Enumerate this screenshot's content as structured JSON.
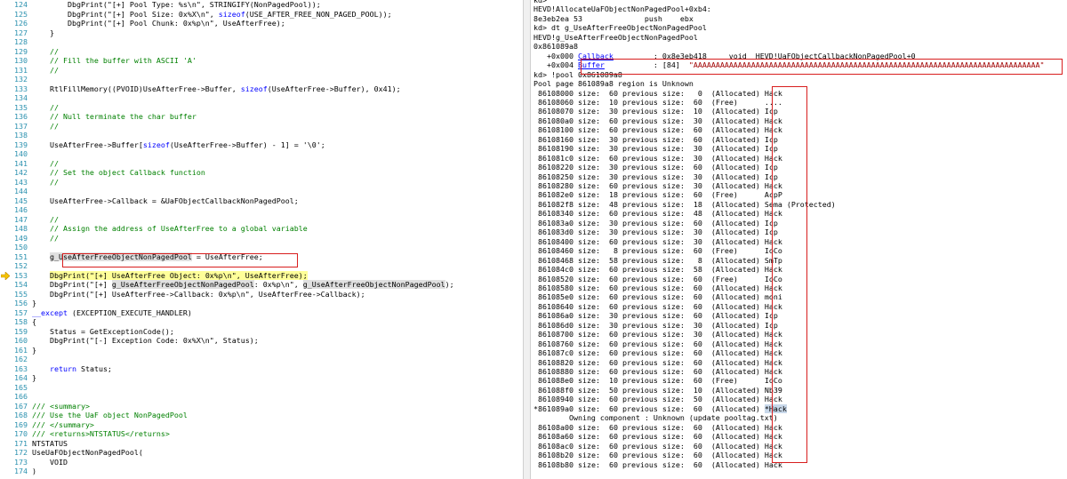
{
  "code": {
    "lines": [
      {
        "n": "124",
        "segs": [
          {
            "t": "        DbgPrint(\"[+] Pool Type: %s\\n\", STRINGIFY(NonPagedPool));"
          }
        ]
      },
      {
        "n": "125",
        "segs": [
          {
            "t": "        DbgPrint(\"[+] Pool Size: 0x%X\\n\", "
          },
          {
            "t": "sizeof",
            "c": "kw"
          },
          {
            "t": "(USE_AFTER_FREE_NON_PAGED_POOL));"
          }
        ]
      },
      {
        "n": "126",
        "segs": [
          {
            "t": "        DbgPrint(\"[+] Pool Chunk: 0x%p\\n\", UseAfterFree);"
          }
        ]
      },
      {
        "n": "127",
        "segs": [
          {
            "t": "    }"
          }
        ]
      },
      {
        "n": "128",
        "segs": [
          {
            "t": ""
          }
        ]
      },
      {
        "n": "129",
        "segs": [
          {
            "t": "    //",
            "c": "cm"
          }
        ]
      },
      {
        "n": "130",
        "segs": [
          {
            "t": "    // Fill the buffer with ASCII 'A'",
            "c": "cm"
          }
        ]
      },
      {
        "n": "131",
        "segs": [
          {
            "t": "    //",
            "c": "cm"
          }
        ]
      },
      {
        "n": "132",
        "segs": [
          {
            "t": ""
          }
        ]
      },
      {
        "n": "133",
        "segs": [
          {
            "t": "    RtlFillMemory((PVOID)UseAfterFree->Buffer, "
          },
          {
            "t": "sizeof",
            "c": "kw"
          },
          {
            "t": "(UseAfterFree->Buffer), 0x41);"
          }
        ]
      },
      {
        "n": "134",
        "segs": [
          {
            "t": ""
          }
        ]
      },
      {
        "n": "135",
        "segs": [
          {
            "t": "    //",
            "c": "cm"
          }
        ]
      },
      {
        "n": "136",
        "segs": [
          {
            "t": "    // Null terminate the char buffer",
            "c": "cm"
          }
        ]
      },
      {
        "n": "137",
        "segs": [
          {
            "t": "    //",
            "c": "cm"
          }
        ]
      },
      {
        "n": "138",
        "segs": [
          {
            "t": ""
          }
        ]
      },
      {
        "n": "139",
        "segs": [
          {
            "t": "    UseAfterFree->Buffer["
          },
          {
            "t": "sizeof",
            "c": "kw"
          },
          {
            "t": "(UseAfterFree->Buffer) - 1] = '\\0';"
          }
        ]
      },
      {
        "n": "140",
        "segs": [
          {
            "t": ""
          }
        ]
      },
      {
        "n": "141",
        "segs": [
          {
            "t": "    //",
            "c": "cm"
          }
        ]
      },
      {
        "n": "142",
        "segs": [
          {
            "t": "    // Set the object Callback function",
            "c": "cm"
          }
        ]
      },
      {
        "n": "143",
        "segs": [
          {
            "t": "    //",
            "c": "cm"
          }
        ]
      },
      {
        "n": "144",
        "segs": [
          {
            "t": ""
          }
        ]
      },
      {
        "n": "145",
        "segs": [
          {
            "t": "    UseAfterFree->Callback = &UaFObjectCallbackNonPagedPool;"
          }
        ]
      },
      {
        "n": "146",
        "segs": [
          {
            "t": ""
          }
        ]
      },
      {
        "n": "147",
        "segs": [
          {
            "t": "    //",
            "c": "cm"
          }
        ]
      },
      {
        "n": "148",
        "segs": [
          {
            "t": "    // Assign the address of UseAfterFree to a global variable",
            "c": "cm"
          }
        ]
      },
      {
        "n": "149",
        "segs": [
          {
            "t": "    //",
            "c": "cm"
          }
        ]
      },
      {
        "n": "150",
        "segs": [
          {
            "t": ""
          }
        ]
      },
      {
        "n": "151",
        "segs": [
          {
            "t": "    "
          },
          {
            "t": "g_UseAfterFreeObjectNonPagedPool",
            "c": "ref"
          },
          {
            "t": " = UseAfterFree;"
          }
        ]
      },
      {
        "n": "152",
        "segs": [
          {
            "t": ""
          }
        ]
      },
      {
        "n": "153",
        "segs": [
          {
            "t": "    "
          },
          {
            "t": "DbgPrint(\"[+] UseAfterFree Object: 0x%p\\n\", UseAfterFree);",
            "c": "hl"
          }
        ]
      },
      {
        "n": "154",
        "segs": [
          {
            "t": "    DbgPrint(\"[+] "
          },
          {
            "t": "g_UseAfterFreeObjectNonPagedPool",
            "c": "ref"
          },
          {
            "t": ": 0x%p\\n\", "
          },
          {
            "t": "g_UseAfterFreeObjectNonPagedPool",
            "c": "ref"
          },
          {
            "t": ");"
          }
        ]
      },
      {
        "n": "155",
        "segs": [
          {
            "t": "    DbgPrint(\"[+] UseAfterFree->Callback: 0x%p\\n\", UseAfterFree->Callback);"
          }
        ]
      },
      {
        "n": "156",
        "segs": [
          {
            "t": "}"
          }
        ]
      },
      {
        "n": "157",
        "segs": [
          {
            "t": "__except",
            "c": "kw"
          },
          {
            "t": " (EXCEPTION_EXECUTE_HANDLER)"
          }
        ]
      },
      {
        "n": "158",
        "segs": [
          {
            "t": "{"
          }
        ]
      },
      {
        "n": "159",
        "segs": [
          {
            "t": "    Status = GetExceptionCode();"
          }
        ]
      },
      {
        "n": "160",
        "segs": [
          {
            "t": "    DbgPrint(\"[-] Exception Code: 0x%X\\n\", Status);"
          }
        ]
      },
      {
        "n": "161",
        "segs": [
          {
            "t": "}"
          }
        ]
      },
      {
        "n": "162",
        "segs": [
          {
            "t": ""
          }
        ]
      },
      {
        "n": "163",
        "segs": [
          {
            "t": "    "
          },
          {
            "t": "return",
            "c": "kw"
          },
          {
            "t": " Status;"
          }
        ]
      },
      {
        "n": "164",
        "segs": [
          {
            "t": "}"
          }
        ]
      },
      {
        "n": "165",
        "segs": [
          {
            "t": ""
          }
        ]
      },
      {
        "n": "166",
        "segs": [
          {
            "t": ""
          }
        ]
      },
      {
        "n": "167",
        "segs": [
          {
            "t": "/// <summary>",
            "c": "cm"
          }
        ]
      },
      {
        "n": "168",
        "segs": [
          {
            "t": "/// Use the UaF object NonPagedPool",
            "c": "cm"
          }
        ]
      },
      {
        "n": "169",
        "segs": [
          {
            "t": "/// </summary>",
            "c": "cm"
          }
        ]
      },
      {
        "n": "170",
        "segs": [
          {
            "t": "/// <returns>NTSTATUS</returns>",
            "c": "cm"
          }
        ]
      },
      {
        "n": "171",
        "segs": [
          {
            "t": "NTSTATUS"
          }
        ]
      },
      {
        "n": "172",
        "segs": [
          {
            "t": "UseUaFObjectNonPagedPool("
          }
        ]
      },
      {
        "n": "173",
        "segs": [
          {
            "t": "    VOID"
          }
        ]
      },
      {
        "n": "174",
        "segs": [
          {
            "t": ")"
          }
        ]
      }
    ]
  },
  "debugger": {
    "header": [
      {
        "segs": [
          {
            "t": "kd>"
          }
        ]
      },
      {
        "segs": [
          {
            "t": "HEVD!AllocateUaFObjectNonPagedPool+0xb4:"
          }
        ]
      },
      {
        "segs": [
          {
            "t": "8e3eb2ea 53              push    ebx"
          }
        ]
      },
      {
        "segs": [
          {
            "t": "kd> dt g_UseAfterFreeObjectNonPagedPool"
          }
        ]
      },
      {
        "segs": [
          {
            "t": "HEVD!g_UseAfterFreeObjectNonPagedPool"
          }
        ]
      },
      {
        "segs": [
          {
            "t": "0x861089a8"
          }
        ]
      },
      {
        "segs": [
          {
            "t": "   +0x000 "
          },
          {
            "t": "Callback",
            "c": "lnk"
          },
          {
            "t": "         : 0x8e3eb418     void  HEVD!UaFObjectCallbackNonPagedPool+0"
          }
        ]
      },
      {
        "segs": [
          {
            "t": "   +0x004 "
          },
          {
            "t": "Buffer",
            "c": "lnk"
          },
          {
            "t": "           : [84]  "
          },
          {
            "t": "\"AAAAAAAAAAAAAAAAAAAAAAAAAAAAAAAAAAAAAAAAAAAAAAAAAAAAAAAAAAAAAAAAAAAAAAAAAAAAAA\"",
            "c": "strval"
          }
        ]
      },
      {
        "segs": [
          {
            "t": "kd> !pool 0x861089a8"
          }
        ]
      },
      {
        "segs": [
          {
            "t": "Pool page 861089a8 region is Unknown"
          }
        ]
      }
    ],
    "pool_rows": [
      [
        "86108000",
        "60",
        "0",
        "(Allocated)",
        "Hack"
      ],
      [
        "86108060",
        "10",
        "60",
        "(Free)",
        "...."
      ],
      [
        "86108070",
        "30",
        "10",
        "(Allocated)",
        "Icp"
      ],
      [
        "861080a0",
        "60",
        "30",
        "(Allocated)",
        "Hack"
      ],
      [
        "86108100",
        "60",
        "60",
        "(Allocated)",
        "Hack"
      ],
      [
        "86108160",
        "30",
        "60",
        "(Allocated)",
        "Icp"
      ],
      [
        "86108190",
        "30",
        "30",
        "(Allocated)",
        "Icp"
      ],
      [
        "861081c0",
        "60",
        "30",
        "(Allocated)",
        "Hack"
      ],
      [
        "86108220",
        "30",
        "60",
        "(Allocated)",
        "Icp"
      ],
      [
        "86108250",
        "30",
        "30",
        "(Allocated)",
        "Icp"
      ],
      [
        "86108280",
        "60",
        "30",
        "(Allocated)",
        "Hack"
      ],
      [
        "861082e0",
        "18",
        "60",
        "(Free)",
        "AcpP"
      ],
      [
        "861082f8",
        "48",
        "18",
        "(Allocated)",
        "Sema (Protected)"
      ],
      [
        "86108340",
        "60",
        "48",
        "(Allocated)",
        "Hack"
      ],
      [
        "861083a0",
        "30",
        "60",
        "(Allocated)",
        "Icp"
      ],
      [
        "861083d0",
        "30",
        "30",
        "(Allocated)",
        "Icp"
      ],
      [
        "86108400",
        "60",
        "30",
        "(Allocated)",
        "Hack"
      ],
      [
        "86108460",
        "8",
        "60",
        "(Free)",
        "IoCo"
      ],
      [
        "86108468",
        "58",
        "8",
        "(Allocated)",
        "SmTp"
      ],
      [
        "861084c0",
        "60",
        "58",
        "(Allocated)",
        "Hack"
      ],
      [
        "86108520",
        "60",
        "60",
        "(Free)",
        "IoCo"
      ],
      [
        "86108580",
        "60",
        "60",
        "(Allocated)",
        "Hack"
      ],
      [
        "861085e0",
        "60",
        "60",
        "(Allocated)",
        "moni"
      ],
      [
        "86108640",
        "60",
        "60",
        "(Allocated)",
        "Hack"
      ],
      [
        "861086a0",
        "30",
        "60",
        "(Allocated)",
        "Icp"
      ],
      [
        "861086d0",
        "30",
        "30",
        "(Allocated)",
        "Icp"
      ],
      [
        "86108700",
        "60",
        "30",
        "(Allocated)",
        "Hack"
      ],
      [
        "86108760",
        "60",
        "60",
        "(Allocated)",
        "Hack"
      ],
      [
        "861087c0",
        "60",
        "60",
        "(Allocated)",
        "Hack"
      ],
      [
        "86108820",
        "60",
        "60",
        "(Allocated)",
        "Hack"
      ],
      [
        "86108880",
        "60",
        "60",
        "(Allocated)",
        "Hack"
      ],
      [
        "861088e0",
        "10",
        "60",
        "(Free)",
        "IoCo"
      ],
      [
        "861088f0",
        "50",
        "10",
        "(Allocated)",
        "Nb39"
      ],
      [
        "86108940",
        "60",
        "50",
        "(Allocated)",
        "Hack"
      ],
      [
        "*861089a0",
        "60",
        "60",
        "(Allocated)",
        "*Hack"
      ]
    ],
    "owner_line": "        Owning component : Unknown (update pooltag.txt)",
    "pool_rows_after": [
      [
        "86108a00",
        "60",
        "60",
        "(Allocated)",
        "Hack"
      ],
      [
        "86108a60",
        "60",
        "60",
        "(Allocated)",
        "Hack"
      ],
      [
        "86108ac0",
        "60",
        "60",
        "(Allocated)",
        "Hack"
      ],
      [
        "86108b20",
        "60",
        "60",
        "(Allocated)",
        "Hack"
      ],
      [
        "86108b80",
        "60",
        "60",
        "(Allocated)",
        "Hack"
      ]
    ],
    "size_label": "size:",
    "prev_label": "previous size:"
  }
}
